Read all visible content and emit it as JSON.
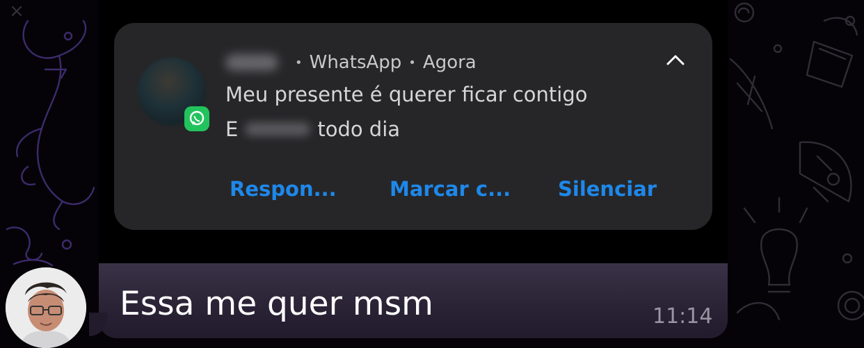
{
  "notification": {
    "app_name": "WhatsApp",
    "time": "Agora",
    "line1": "Meu presente é querer ficar contigo",
    "line2_start": "E",
    "line2_end": "todo dia",
    "actions": [
      "Respon...",
      "Marcar c...",
      "Silenciar"
    ],
    "icons": {
      "app_badge": "whatsapp-icon",
      "collapse": "chevron-up-icon"
    }
  },
  "message": {
    "text": "Essa me quer msm",
    "time": "11:14"
  },
  "colors": {
    "action_blue": "#1e88ea",
    "notification_bg": "#262628",
    "whatsapp_green": "#22c35d",
    "bubble_footer": "#2b2336",
    "doodle_purple": "#3b2c6c"
  }
}
